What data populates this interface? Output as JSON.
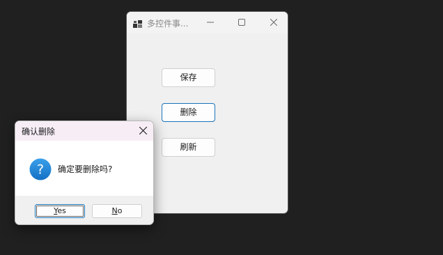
{
  "main_window": {
    "title": "多控件事...",
    "buttons": {
      "save": "保存",
      "delete": "删除",
      "refresh": "刷新"
    }
  },
  "dialog": {
    "title": "确认删除",
    "message": "确定要删除吗?",
    "icon": "question-icon",
    "yes": {
      "mnemonic": "Y",
      "rest": "es"
    },
    "no": {
      "mnemonic": "N",
      "rest": "o"
    }
  },
  "colors": {
    "desktop": "#202020",
    "window_bg": "#f0f0f0",
    "dialog_title_bg": "#f7eef5",
    "accent": "#1a73b8",
    "question_icon": "#1e88d8"
  }
}
